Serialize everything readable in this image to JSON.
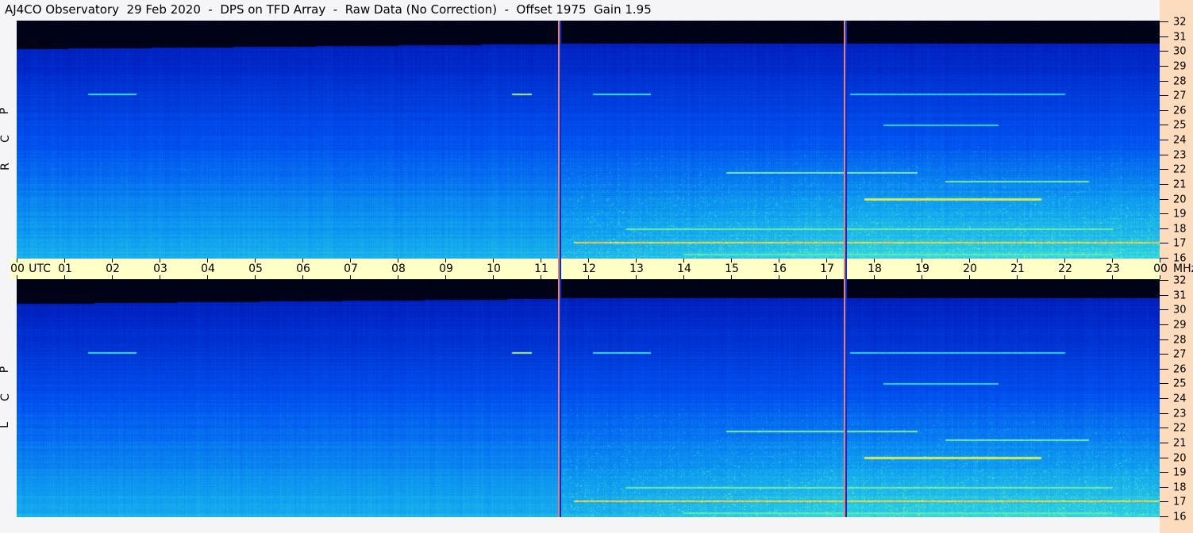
{
  "title": "AJ4CO Observatory  29 Feb 2020  -  DPS on TFD Array  -  Raw Data (No Correction)  -  Offset 1975  Gain 1.95",
  "colors": {
    "background": "#f5f5f7",
    "side_strip": "#fcdcbc",
    "time_axis_bar": "#ffffc8",
    "marker_line": "#f08070"
  },
  "chart_data": {
    "type": "heatmap",
    "title": "AJ4CO Observatory  29 Feb 2020  -  DPS on TFD Array  -  Raw Data (No Correction)  -  Offset 1975  Gain 1.95",
    "xlabel": "UTC",
    "ylabel": "MHz",
    "x_ticks": [
      "00",
      "01",
      "02",
      "03",
      "04",
      "05",
      "06",
      "07",
      "08",
      "09",
      "10",
      "11",
      "12",
      "13",
      "14",
      "15",
      "16",
      "17",
      "18",
      "19",
      "20",
      "21",
      "22",
      "23",
      "00"
    ],
    "y_ticks": [
      "32",
      "31",
      "30",
      "29",
      "28",
      "27",
      "26",
      "25",
      "24",
      "23",
      "22",
      "21",
      "20",
      "19",
      "18",
      "17",
      "16"
    ],
    "xlim": [
      0,
      24
    ],
    "ylim": [
      16,
      32
    ],
    "panels": [
      {
        "label_letters": [
          "R",
          "C",
          "P"
        ]
      },
      {
        "label_letters": [
          "L",
          "C",
          "P"
        ]
      }
    ],
    "marker_times_utc": [
      11.37,
      17.37
    ],
    "colormap": [
      "#000000",
      "#000a50",
      "#0020c0",
      "#0050f0",
      "#10a0f0",
      "#30d8e0",
      "#80f0a0",
      "#f0f040",
      "#ff8040",
      "#ff40ff"
    ],
    "emission_lines": [
      {
        "mhz": 27.05,
        "from_utc": 1.5,
        "to_utc": 2.5,
        "level": 0.78
      },
      {
        "mhz": 27.05,
        "from_utc": 10.4,
        "to_utc": 10.8,
        "level": 0.9
      },
      {
        "mhz": 27.05,
        "from_utc": 12.1,
        "to_utc": 13.3,
        "level": 0.78
      },
      {
        "mhz": 27.05,
        "from_utc": 17.5,
        "to_utc": 22.0,
        "level": 0.75
      },
      {
        "mhz": 25.0,
        "from_utc": 18.2,
        "to_utc": 20.6,
        "level": 0.76
      },
      {
        "mhz": 21.8,
        "from_utc": 14.9,
        "to_utc": 18.9,
        "level": 0.85
      },
      {
        "mhz": 21.2,
        "from_utc": 19.5,
        "to_utc": 22.5,
        "level": 0.84
      },
      {
        "mhz": 20.0,
        "from_utc": 17.8,
        "to_utc": 21.5,
        "level": 0.92
      },
      {
        "mhz": 18.0,
        "from_utc": 12.8,
        "to_utc": 23.0,
        "level": 0.84
      },
      {
        "mhz": 17.1,
        "from_utc": 11.7,
        "to_utc": 24.0,
        "level": 0.95
      },
      {
        "mhz": 16.3,
        "from_utc": 14.0,
        "to_utc": 23.0,
        "level": 0.82
      }
    ]
  }
}
